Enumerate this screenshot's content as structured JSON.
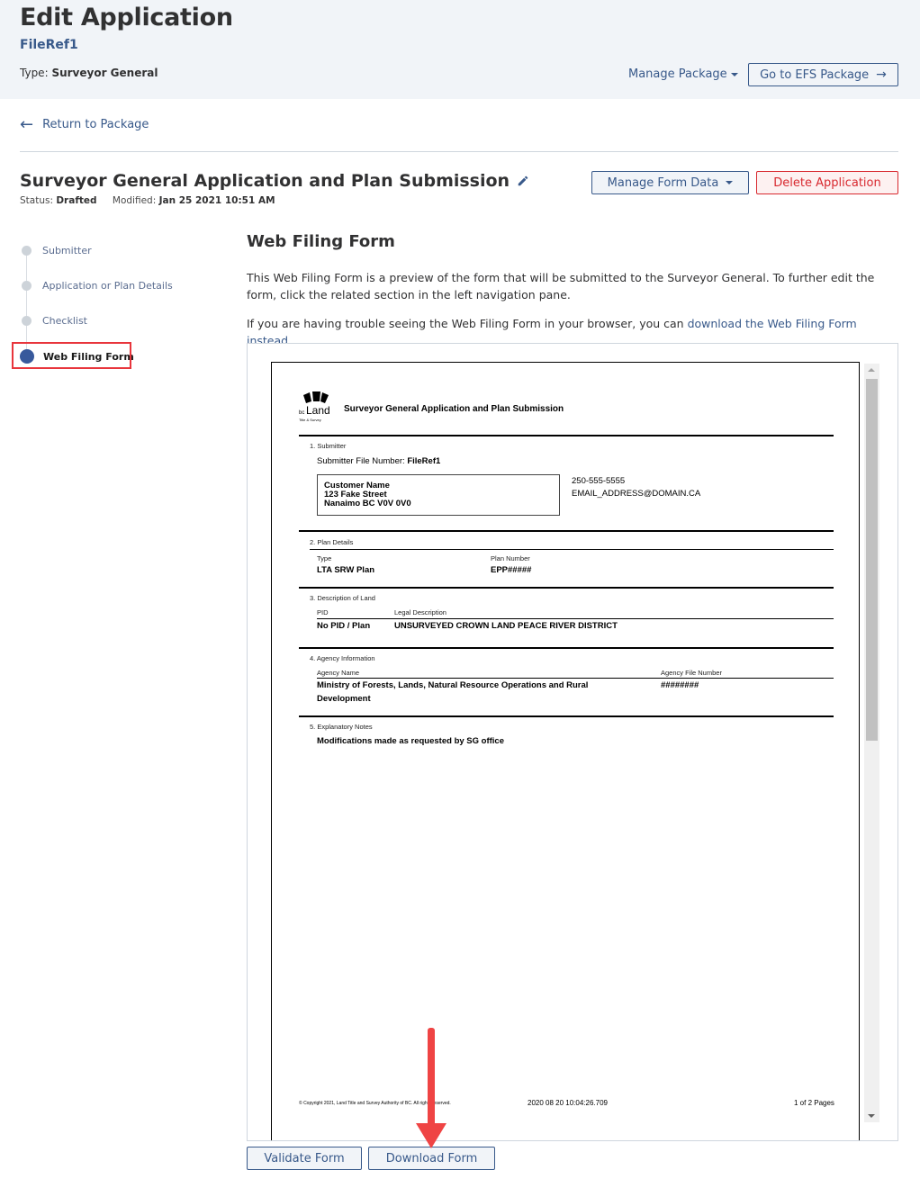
{
  "header": {
    "title": "Edit Application",
    "file_ref": "FileRef1",
    "type_label": "Type:",
    "type_value": "Surveyor General",
    "manage_package": "Manage Package",
    "go_to_efs": "Go to EFS Package"
  },
  "nav": {
    "return_label": "Return to Package"
  },
  "application": {
    "title": "Surveyor General Application and Plan Submission",
    "status_label": "Status:",
    "status_value": "Drafted",
    "modified_label": "Modified:",
    "modified_value": "Jan 25 2021 10:51 AM",
    "manage_form_data": "Manage Form Data",
    "delete_application": "Delete Application"
  },
  "steps": [
    {
      "label": "Submitter",
      "active": false
    },
    {
      "label": "Application or Plan Details",
      "active": false
    },
    {
      "label": "Checklist",
      "active": false
    },
    {
      "label": "Web Filing Form",
      "active": true
    }
  ],
  "content": {
    "title": "Web Filing Form",
    "intro": "This Web Filing Form is a preview of the form that will be submitted to the Surveyor General. To further edit the form, click the related section in the left navigation pane.",
    "trouble_prefix": "If you are having trouble seeing the Web Filing Form in your browser, you can ",
    "trouble_link": "download the Web Filing Form instead",
    "trouble_suffix": "."
  },
  "pdf": {
    "logo_text": "Land",
    "logo_prefix": "bc",
    "logo_sub": "Title & Survey",
    "form_title": "Surveyor General Application and Plan Submission",
    "s1_title": "1. Submitter",
    "submitter_file_label": "Submitter File Number:",
    "submitter_file_value": "FileRef1",
    "address_lines": [
      "Customer Name",
      "123 Fake Street",
      "Nanaimo BC V0V 0V0"
    ],
    "phone": "250-555-5555",
    "email": "EMAIL_ADDRESS@DOMAIN.CA",
    "s2_title": "2. Plan Details",
    "type_label": "Type",
    "type_value": "LTA SRW Plan",
    "plan_number_label": "Plan Number",
    "plan_number_value": "EPP#####",
    "s3_title": "3. Description of Land",
    "pid_label": "PID",
    "pid_value": "No PID / Plan",
    "legal_label": "Legal Description",
    "legal_value": "UNSURVEYED CROWN LAND PEACE RIVER DISTRICT",
    "s4_title": "4. Agency Information",
    "agency_name_label": "Agency Name",
    "agency_name_value_1": "Ministry of Forests, Lands, Natural Resource Operations and Rural",
    "agency_name_value_2": "Development",
    "agency_file_label": "Agency File Number",
    "agency_file_value": "########",
    "s5_title": "5. Explanatory Notes",
    "notes_value": "Modifications made as requested by SG office",
    "footer_copyright": "© Copyright 2021, Land Title and Survey Authority of BC. All rights reserved.",
    "footer_timestamp": "2020 08 20 10:04:26.709",
    "footer_pages": "1 of 2 Pages"
  },
  "actions": {
    "validate": "Validate Form",
    "download": "Download Form"
  },
  "colors": {
    "primary": "#38598a",
    "danger": "#d8292f",
    "header_bg": "#f1f4f8",
    "highlight": "#e8353c"
  }
}
